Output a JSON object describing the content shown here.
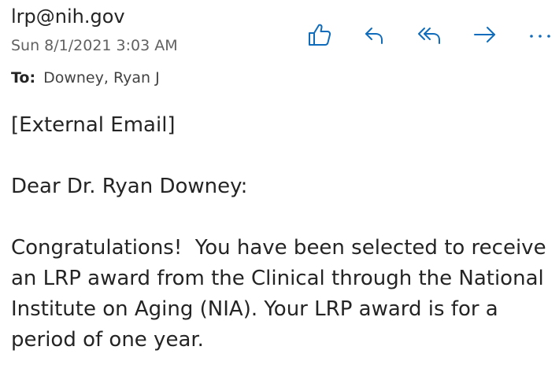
{
  "header": {
    "sender": "lrp@nih.gov",
    "date": "Sun 8/1/2021 3:03 AM",
    "to_label": "To:",
    "to_value": "Downey, Ryan J"
  },
  "actions": [
    {
      "name": "like",
      "icon": "thumbs-up-icon"
    },
    {
      "name": "reply",
      "icon": "reply-icon"
    },
    {
      "name": "reply-all",
      "icon": "reply-all-icon"
    },
    {
      "name": "forward",
      "icon": "forward-arrow-icon"
    },
    {
      "name": "more",
      "icon": "more-ellipsis-icon"
    }
  ],
  "colors": {
    "accent": "#0f6cbd",
    "text": "#242424",
    "secondary_text": "#616161"
  },
  "message": {
    "line1": "[External Email]",
    "greeting": "Dear Dr. Ryan Downey:",
    "paragraph": "Congratulations!  You have been selected to receive an LRP award from the Clinical through the National Institute on Aging (NIA). Your LRP award is for a period of one year."
  }
}
